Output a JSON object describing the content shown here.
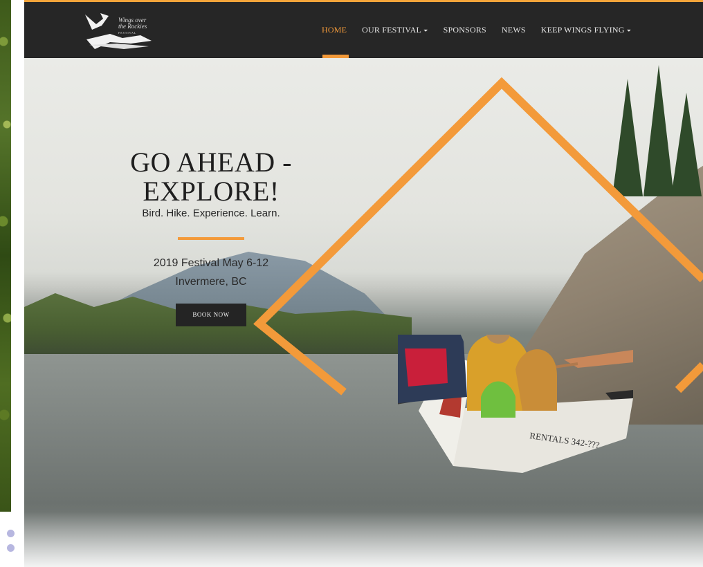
{
  "logo": {
    "line1": "Wings over",
    "line2": "the Rockies",
    "line3": "FESTIVAL"
  },
  "nav": {
    "items": [
      {
        "label": "HOME",
        "dropdown": false
      },
      {
        "label": "OUR FESTIVAL",
        "dropdown": true
      },
      {
        "label": "SPONSORS",
        "dropdown": false
      },
      {
        "label": "NEWS",
        "dropdown": false
      },
      {
        "label": "KEEP WINGS FLYING",
        "dropdown": true
      }
    ],
    "caret": "⏷"
  },
  "hero": {
    "headline_line1": "GO AHEAD -",
    "headline_line2": "EXPLORE!",
    "tagline": "Bird. Hike. Experience. Learn.",
    "festival_dates": "2019 Festival May 6-12",
    "location": "Invermere, BC",
    "cta_label": "BOOK NOW"
  },
  "canoe_text": "RENTALS 342-???",
  "colors": {
    "accent": "#f39a3a",
    "navbar": "#262626",
    "cta": "#242424"
  }
}
